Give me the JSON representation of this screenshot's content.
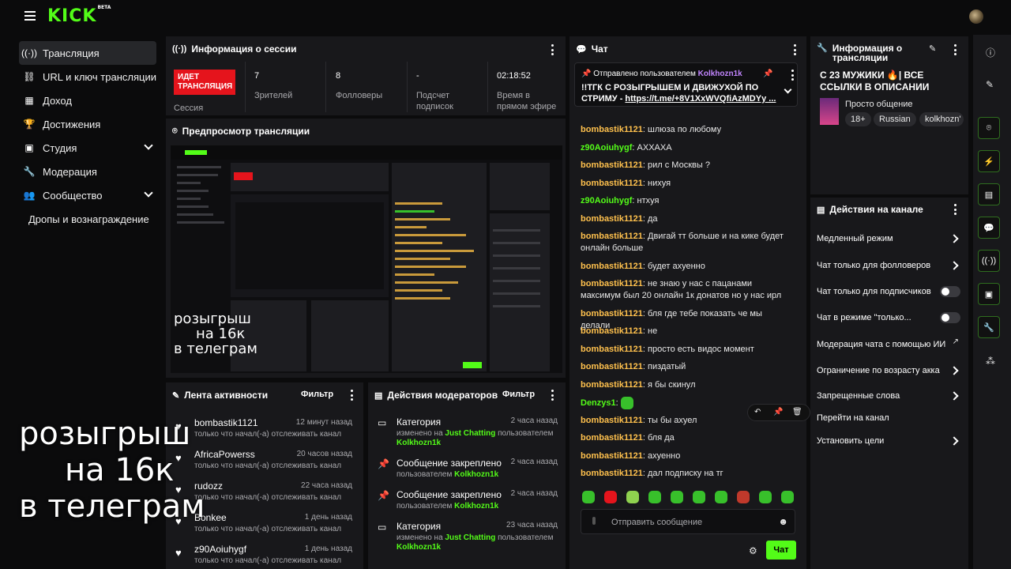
{
  "brand": {
    "logo": "KICK",
    "badge": "BETA",
    "accent": "#53fc18",
    "live_color": "#e5141c"
  },
  "sidebar": {
    "items": [
      {
        "label": "Трансляция",
        "icon": "broadcast-icon"
      },
      {
        "label": "URL и ключ трансляции",
        "icon": "link-icon"
      },
      {
        "label": "Доход",
        "icon": "chart-icon"
      },
      {
        "label": "Достижения",
        "icon": "trophy-icon"
      },
      {
        "label": "Студия",
        "icon": "studio-icon"
      },
      {
        "label": "Модерация",
        "icon": "wrench-icon"
      },
      {
        "label": "Сообщество",
        "icon": "community-icon"
      },
      {
        "label": "Дропы и вознаграждение",
        "icon": ""
      }
    ]
  },
  "session": {
    "title": "Информация о сессии",
    "live_badge": "ИДЕТ ТРАНСЛЯЦИЯ",
    "session_label": "Сессия",
    "viewers": "7",
    "viewers_label": "Зрителей",
    "followers": "8",
    "followers_label": "Фолловеры",
    "subs": "-",
    "subs_label": "Подсчет подписок",
    "uptime": "02:18:52",
    "uptime_label": "Время в прямом эфире"
  },
  "preview": {
    "title": "Предпросмотр трансляции",
    "overlay_line1": "розыгрыш",
    "overlay_line2": "на 16к",
    "overlay_line3": "в телеграм"
  },
  "activity": {
    "title": "Лента активности",
    "filter": "Фильтр",
    "rows": [
      {
        "name": "bombastik1121",
        "time": "12 минут назад",
        "sub": "только что начал(-а) отслеживать канал"
      },
      {
        "name": "AfricaPowerss",
        "time": "20 часов назад",
        "sub": "только что начал(-а) отслеживать канал"
      },
      {
        "name": "rudozz",
        "time": "22 часа назад",
        "sub": "только что начал(-а) отслеживать канал"
      },
      {
        "name": "Bonkee",
        "time": "1 день назад",
        "sub": "только что начал(-а) отслеживать канал"
      },
      {
        "name": "z90Aoiuhygf",
        "time": "1 день назад",
        "sub": "только что начал(-а) отслеживать канал"
      }
    ]
  },
  "modactions": {
    "title": "Действия модераторов",
    "filter": "Фильтр",
    "rows": [
      {
        "title": "Категория",
        "time": "2 часа назад",
        "pre": "изменено на ",
        "hl": "Just Chatting",
        "mid": " пользователем ",
        "user": "Kolkhozn1k"
      },
      {
        "title": "Сообщение закреплено",
        "time": "2 часа назад",
        "pre": "пользователем ",
        "hl": "",
        "mid": "",
        "user": "Kolkhozn1k"
      },
      {
        "title": "Сообщение закреплено",
        "time": "2 часа назад",
        "pre": "пользователем ",
        "hl": "",
        "mid": "",
        "user": "Kolkhozn1k"
      },
      {
        "title": "Категория",
        "time": "23 часа назад",
        "pre": "изменено на ",
        "hl": "Just Chatting",
        "mid": " пользователем ",
        "user": "Kolkhozn1k"
      }
    ]
  },
  "chat": {
    "title": "Чат",
    "pinned_by": "Отправлено пользователем",
    "pinned_user": "Kolkhozn1k",
    "pinned_text": "!!ТГК С РОЗЫГРЫШЕМ И ДВИЖУХОЙ ПО СТРИМУ - ",
    "pinned_link": "https://t.me/+8V1XxWVQfiAzMDYy ...",
    "messages": [
      {
        "user": "bombastik1121",
        "text": "шлюза по любому",
        "green": false
      },
      {
        "user": "z90Aoiuhygf",
        "text": "АХХАХА",
        "green": true
      },
      {
        "user": "bombastik1121",
        "text": "рил с Москвы ?",
        "green": false
      },
      {
        "user": "bombastik1121",
        "text": "нихуя",
        "green": false
      },
      {
        "user": "z90Aoiuhygf",
        "text": "нтхуя",
        "green": true
      },
      {
        "user": "bombastik1121",
        "text": "да",
        "green": false
      },
      {
        "user": "bombastik1121",
        "text": "Двигай тт больше и на кике будет онлайн больше",
        "green": false
      },
      {
        "user": "bombastik1121",
        "text": "будет ахуенно",
        "green": false
      },
      {
        "user": "bombastik1121",
        "text": "не знаю у нас с пацанами максимум был 20 онлайн 1к донатов но у нас ирл",
        "green": false
      },
      {
        "user": "bombastik1121",
        "text": "бля где тебе показать че мы делали",
        "green": false
      },
      {
        "user": "bombastik1121",
        "text": "не",
        "green": false
      },
      {
        "user": "bombastik1121",
        "text": "просто есть видос момент",
        "green": false
      },
      {
        "user": "bombastik1121",
        "text": "пиздатый",
        "green": false
      },
      {
        "user": "bombastik1121",
        "text": "я бы скинул",
        "green": false
      },
      {
        "user": "Denzys1",
        "text": "",
        "green": true
      },
      {
        "user": "bombastik1121",
        "text": "ты бы ахуел",
        "green": false
      },
      {
        "user": "bombastik1121",
        "text": "бля да",
        "green": false
      },
      {
        "user": "bombastik1121",
        "text": "ахуенно",
        "green": false
      },
      {
        "user": "bombastik1121",
        "text": "дал подписку на тг",
        "green": false
      }
    ],
    "input_placeholder": "Отправить сообщение",
    "send_label": "Чат"
  },
  "stream_info": {
    "title": "Информация о трансляции",
    "stream_title": "С 23 МУЖИКИ 🔥| ВСЕ ССЫЛКИ В ОПИСАНИИ",
    "category": "Просто общение",
    "tags": [
      "18+",
      "Russian",
      "kolkhozn'"
    ]
  },
  "channel_actions": {
    "title": "Действия на канале",
    "rows": [
      {
        "label": "Медленный режим",
        "kind": "chevron"
      },
      {
        "label": "Чат только для фолловеров",
        "kind": "chevron"
      },
      {
        "label": "Чат только для подписчиков",
        "kind": "toggle"
      },
      {
        "label": "Чат в режиме \"только...",
        "kind": "toggle"
      },
      {
        "label": "Модерация чата с помощью ИИ",
        "kind": "external"
      },
      {
        "label": "Ограничение по возрасту акка",
        "kind": "chevron"
      },
      {
        "label": "Запрещенные слова",
        "kind": "chevron"
      },
      {
        "label": "Перейти на канал",
        "kind": "none"
      },
      {
        "label": "Установить цели",
        "kind": "chevron"
      }
    ]
  },
  "overlay": {
    "line1": "розыгрыш",
    "line2": "на 16к",
    "line3": "в телеграм"
  }
}
